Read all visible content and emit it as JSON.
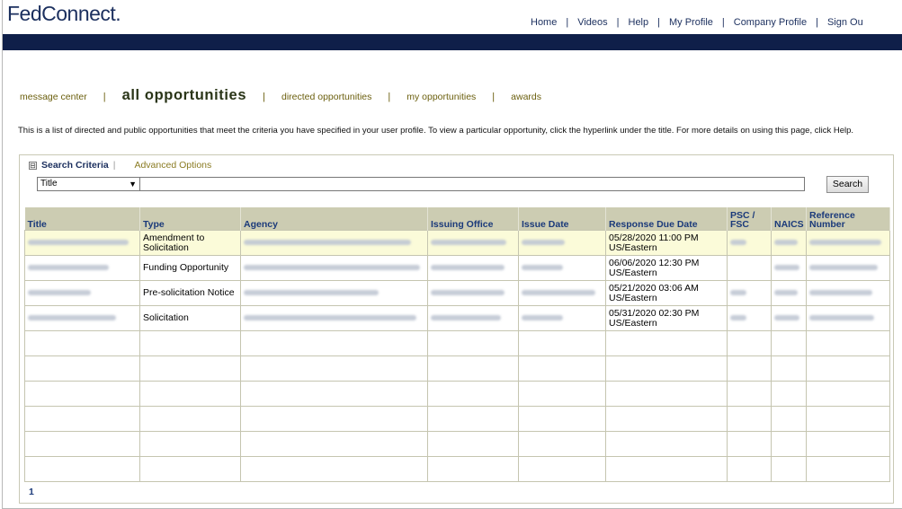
{
  "brand": {
    "logo": "FedConnect."
  },
  "top_nav": [
    "Home",
    "Videos",
    "Help",
    "My Profile",
    "Company Profile",
    "Sign Ou"
  ],
  "sub_nav": {
    "message_center": "message center",
    "all_opportunities": "all opportunities",
    "directed_opportunities": "directed opportunities",
    "my_opportunities": "my opportunities",
    "awards": "awards"
  },
  "intro_text": "This is a list of directed and public opportunities that meet the criteria you have specified in your user profile. To view a particular opportunity, click the hyperlink under the title. For more details on using this page, click Help.",
  "search": {
    "criteria_label": "Search Criteria",
    "toggle_symbol": "⊟",
    "advanced_label": "Advanced Options",
    "field_value": "Title",
    "query": "",
    "button_label": "Search"
  },
  "table": {
    "headers": {
      "title": "Title",
      "type": "Type",
      "agency": "Agency",
      "issuing_office": "Issuing Office",
      "issue_date": "Issue Date",
      "response_due": "Response Due Date",
      "psc_line1": "PSC /",
      "psc_line2": "FSC",
      "naics": "NAICS",
      "ref_line1": "Reference",
      "ref_line2": "Number"
    },
    "rows": [
      {
        "type": "Amendment to Solicitation",
        "due_line1": "05/28/2020 11:00 PM",
        "due_line2": "US/Eastern"
      },
      {
        "type": "Funding Opportunity",
        "due_line1": "06/06/2020 12:30 PM",
        "due_line2": "US/Eastern"
      },
      {
        "type": "Pre-solicitation Notice",
        "due_line1": "05/21/2020 03:06 AM",
        "due_line2": "US/Eastern"
      },
      {
        "type": "Solicitation",
        "due_line1": "05/31/2020 02:30 PM",
        "due_line2": "US/Eastern"
      }
    ]
  },
  "pager": {
    "page": "1"
  },
  "colors": {
    "nav_blue": "#1b2f5e",
    "header_bar": "#0f1f49",
    "table_header": "#ccccb2",
    "highlight_row": "#fbfbd9"
  }
}
